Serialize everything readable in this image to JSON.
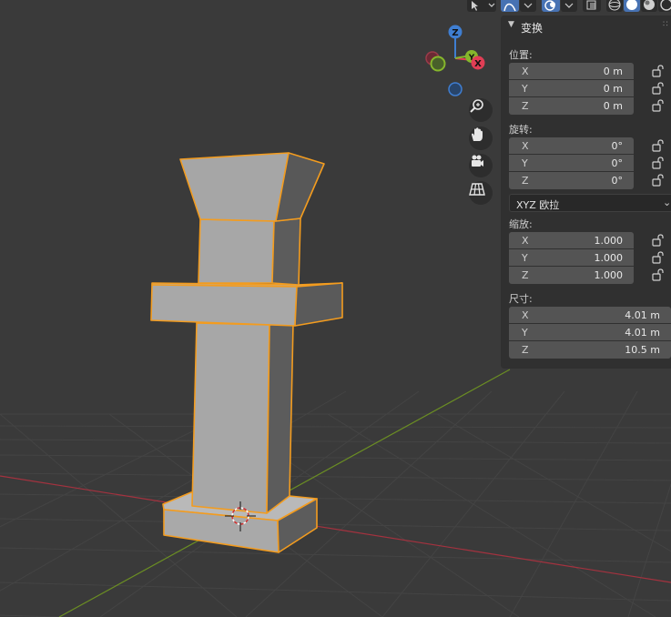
{
  "header": {
    "icons": [
      "select-tool-icon",
      "chevron-down-icon",
      "curve-icon",
      "chevron-down-icon",
      "overlay-icon",
      "chevron-down-icon",
      "xray-icon",
      "wireframe-shading-icon",
      "solid-shading-icon",
      "material-shading-icon",
      "rendered-shading-icon"
    ]
  },
  "gizmo": {
    "axes": {
      "z": "Z",
      "y": "Y",
      "x": "X"
    },
    "colors": {
      "x": "#e03e55",
      "y": "#86b62c",
      "z": "#3f7ed1"
    }
  },
  "navigation": {
    "icons": [
      "zoom-icon",
      "pan-hand-icon",
      "camera-icon",
      "perspective-grid-icon"
    ]
  },
  "panel": {
    "title": "变换",
    "location": {
      "label": "位置:",
      "rows": [
        {
          "axis": "X",
          "value": "0 m"
        },
        {
          "axis": "Y",
          "value": "0 m"
        },
        {
          "axis": "Z",
          "value": "0 m"
        }
      ]
    },
    "rotation": {
      "label": "旋转:",
      "rows": [
        {
          "axis": "X",
          "value": "0°"
        },
        {
          "axis": "Y",
          "value": "0°"
        },
        {
          "axis": "Z",
          "value": "0°"
        }
      ],
      "mode": "XYZ 欧拉"
    },
    "scale": {
      "label": "缩放:",
      "rows": [
        {
          "axis": "X",
          "value": "1.000"
        },
        {
          "axis": "Y",
          "value": "1.000"
        },
        {
          "axis": "Z",
          "value": "1.000"
        }
      ]
    },
    "dimensions": {
      "label": "尺寸:",
      "rows": [
        {
          "axis": "X",
          "value": "4.01 m"
        },
        {
          "axis": "Y",
          "value": "4.01 m"
        },
        {
          "axis": "Z",
          "value": "10.5 m"
        }
      ]
    }
  },
  "colors": {
    "viewport_bg": "#3a3a3a",
    "grid": "#444444",
    "x_axis": "#a4323f",
    "y_axis": "#6b8e23",
    "selection_outline": "#f39c1f",
    "mesh_light": "#a8a8a8",
    "mesh_dark": "#5a5a5a"
  }
}
